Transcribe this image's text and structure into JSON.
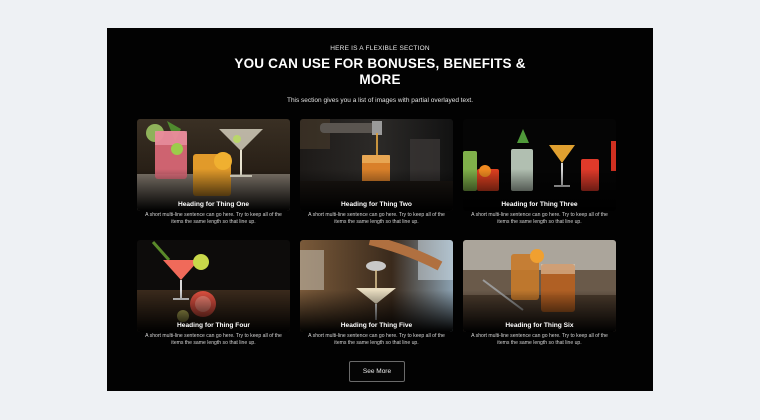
{
  "section": {
    "eyebrow": "HERE IS A FLEXIBLE SECTION",
    "title": "YOU CAN USE FOR BONUSES, BENEFITS & MORE",
    "intro": "This section gives you a list of images with partial overlayed text."
  },
  "cards": [
    {
      "heading": "Heading for Thing One",
      "text": "A short multi-line sentence can go here. Try to keep all of the items the same length so that line up.",
      "image": "cocktail-glasses-photo"
    },
    {
      "heading": "Heading for Thing Two",
      "text": "A short multi-line sentence can go here. Try to keep all of the items the same length so that line up.",
      "image": "bartender-pouring-photo"
    },
    {
      "heading": "Heading for Thing Three",
      "text": "A short multi-line sentence can go here. Try to keep all of the items the same length so that line up.",
      "image": "cocktail-lineup-photo"
    },
    {
      "heading": "Heading for Thing Four",
      "text": "A short multi-line sentence can go here. Try to keep all of the items the same length so that line up.",
      "image": "grapefruit-cocktail-photo"
    },
    {
      "heading": "Heading for Thing Five",
      "text": "A short multi-line sentence can go here. Try to keep all of the items the same length so that line up.",
      "image": "strained-cocktail-photo"
    },
    {
      "heading": "Heading for Thing Six",
      "text": "A short multi-line sentence can go here. Try to keep all of the items the same length so that line up.",
      "image": "whiskey-glasses-photo"
    }
  ],
  "cta": {
    "label": "See More"
  }
}
